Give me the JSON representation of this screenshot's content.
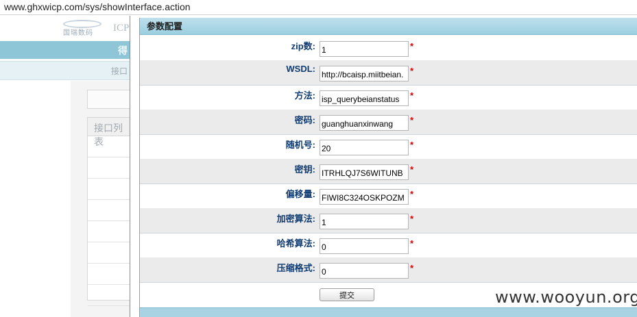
{
  "browser": {
    "url": "www.ghxwicp.com/sys/showInterface.action"
  },
  "background_page": {
    "logo_text": "国瑞数码",
    "brand_text": "ICP",
    "bar1_text": "得",
    "bar2_text": "接口",
    "list_header": "接口列表",
    "list_rows": [
      "",
      "",
      "",
      "",
      "",
      "",
      "",
      ""
    ]
  },
  "dialog": {
    "title": "参数配置",
    "fields": [
      {
        "label": "zip数:",
        "value": "1",
        "required": "*"
      },
      {
        "label": "WSDL:",
        "value": "http://bcaisp.miitbeian.",
        "required": "*"
      },
      {
        "label": "方法:",
        "value": "isp_querybeianstatus",
        "required": "*"
      },
      {
        "label": "密码:",
        "value": "guanghuanxinwang",
        "required": "*"
      },
      {
        "label": "随机号:",
        "value": "20",
        "required": "*"
      },
      {
        "label": "密钥:",
        "value": "ITRHLQJ7S6WITUNB",
        "required": "*"
      },
      {
        "label": "偏移量:",
        "value": "FIWI8C324OSKPOZM",
        "required": "*"
      },
      {
        "label": "加密算法:",
        "value": "1",
        "required": "*"
      },
      {
        "label": "哈希算法:",
        "value": "0",
        "required": "*"
      },
      {
        "label": "压缩格式:",
        "value": "0",
        "required": "*"
      }
    ],
    "submit_label": "提交"
  },
  "watermark": "www.wooyun.org",
  "colors": {
    "title_bar": "#9ccfe0",
    "label": "#113c72",
    "required": "#e00000",
    "alt_row": "#ebebeb"
  }
}
